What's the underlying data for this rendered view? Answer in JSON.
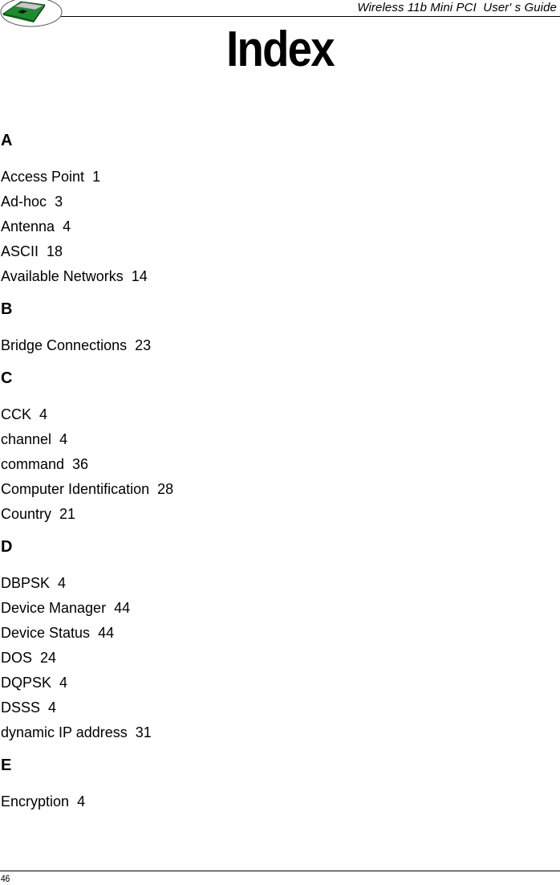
{
  "header": {
    "logo_icon": "mini-pci-card-icon",
    "guide_title": "Wireless 11b Mini PCI  User' s Guide"
  },
  "page_title": "Index",
  "sections": [
    {
      "letter": "A",
      "entries": [
        {
          "term": "Access Point",
          "page": "1"
        },
        {
          "term": "Ad-hoc",
          "page": "3"
        },
        {
          "term": "Antenna",
          "page": "4"
        },
        {
          "term": "ASCII",
          "page": "18"
        },
        {
          "term": "Available Networks",
          "page": "14"
        }
      ]
    },
    {
      "letter": "B",
      "entries": [
        {
          "term": "Bridge Connections",
          "page": "23"
        }
      ]
    },
    {
      "letter": "C",
      "entries": [
        {
          "term": "CCK",
          "page": "4"
        },
        {
          "term": "channel",
          "page": "4"
        },
        {
          "term": "command",
          "page": "36"
        },
        {
          "term": "Computer Identification",
          "page": "28"
        },
        {
          "term": "Country",
          "page": "21"
        }
      ]
    },
    {
      "letter": "D",
      "entries": [
        {
          "term": "DBPSK",
          "page": "4"
        },
        {
          "term": "Device Manager",
          "page": "44"
        },
        {
          "term": "Device Status",
          "page": "44"
        },
        {
          "term": "DOS",
          "page": "24"
        },
        {
          "term": "DQPSK",
          "page": "4"
        },
        {
          "term": "DSSS",
          "page": "4"
        },
        {
          "term": "dynamic IP address",
          "page": "31"
        }
      ]
    },
    {
      "letter": "E",
      "entries": [
        {
          "term": "Encryption",
          "page": "4"
        }
      ]
    }
  ],
  "footer": {
    "page_number": "46"
  }
}
